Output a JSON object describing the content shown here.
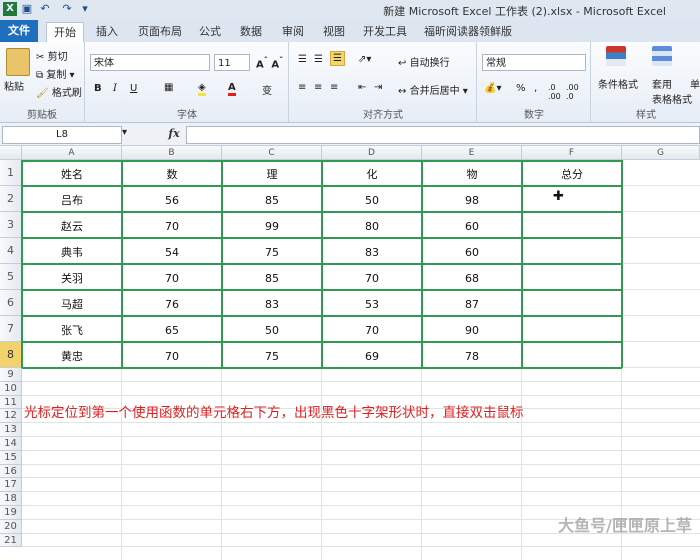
{
  "window": {
    "title": "新建 Microsoft Excel 工作表 (2).xlsx  -  Microsoft Excel"
  },
  "tabs": [
    "文件",
    "开始",
    "插入",
    "页面布局",
    "公式",
    "数据",
    "审阅",
    "视图",
    "开发工具",
    "福昕阅读器领鲜版"
  ],
  "ribbon": {
    "clipboard": {
      "paste": "粘贴",
      "cut": "剪切",
      "copy": "复制",
      "format_painter": "格式刷",
      "label": "剪贴板"
    },
    "font": {
      "name": "宋体",
      "size": "11",
      "bold": "B",
      "italic": "I",
      "underline": "U",
      "wen": "变",
      "label": "字体"
    },
    "align": {
      "wrap": "自动换行",
      "merge": "合并后居中",
      "label": "对齐方式"
    },
    "number": {
      "format": "常规",
      "percent": "%",
      "comma": ",",
      "label": "数字"
    },
    "styles": {
      "cond": "条件格式",
      "table1": "套用",
      "table2": "表格格式",
      "cell": "单",
      "label": "样式"
    }
  },
  "formula_bar": {
    "name_box": "L8",
    "fx": "fx",
    "value": ""
  },
  "columns": [
    "A",
    "B",
    "C",
    "D",
    "E",
    "F",
    "G"
  ],
  "rows": [
    "1",
    "2",
    "3",
    "4",
    "5",
    "6",
    "7",
    "8",
    "9",
    "10",
    "11",
    "12",
    "13",
    "14",
    "15",
    "16",
    "17",
    "18",
    "19",
    "20",
    "21"
  ],
  "selected_row": "8",
  "table": {
    "headers": [
      "姓名",
      "数",
      "理",
      "化",
      "物",
      "总分"
    ],
    "data": [
      [
        "吕布",
        "56",
        "85",
        "50",
        "98",
        ""
      ],
      [
        "赵云",
        "70",
        "99",
        "80",
        "60",
        ""
      ],
      [
        "典韦",
        "54",
        "75",
        "83",
        "60",
        ""
      ],
      [
        "关羽",
        "70",
        "85",
        "70",
        "68",
        ""
      ],
      [
        "马超",
        "76",
        "83",
        "53",
        "87",
        ""
      ],
      [
        "张飞",
        "65",
        "50",
        "70",
        "90",
        ""
      ],
      [
        "黄忠",
        "70",
        "75",
        "69",
        "78",
        ""
      ]
    ]
  },
  "note": "光标定位到第一个使用函数的单元格右下方，出现黑色十字架形状时，直接双击鼠标",
  "watermark": "大鱼号/匣匣原上草",
  "colors": {
    "accent": "#1f6fbf",
    "table_border": "#2f9a52",
    "note": "#e02020",
    "selected_row": "#f2d36b"
  }
}
